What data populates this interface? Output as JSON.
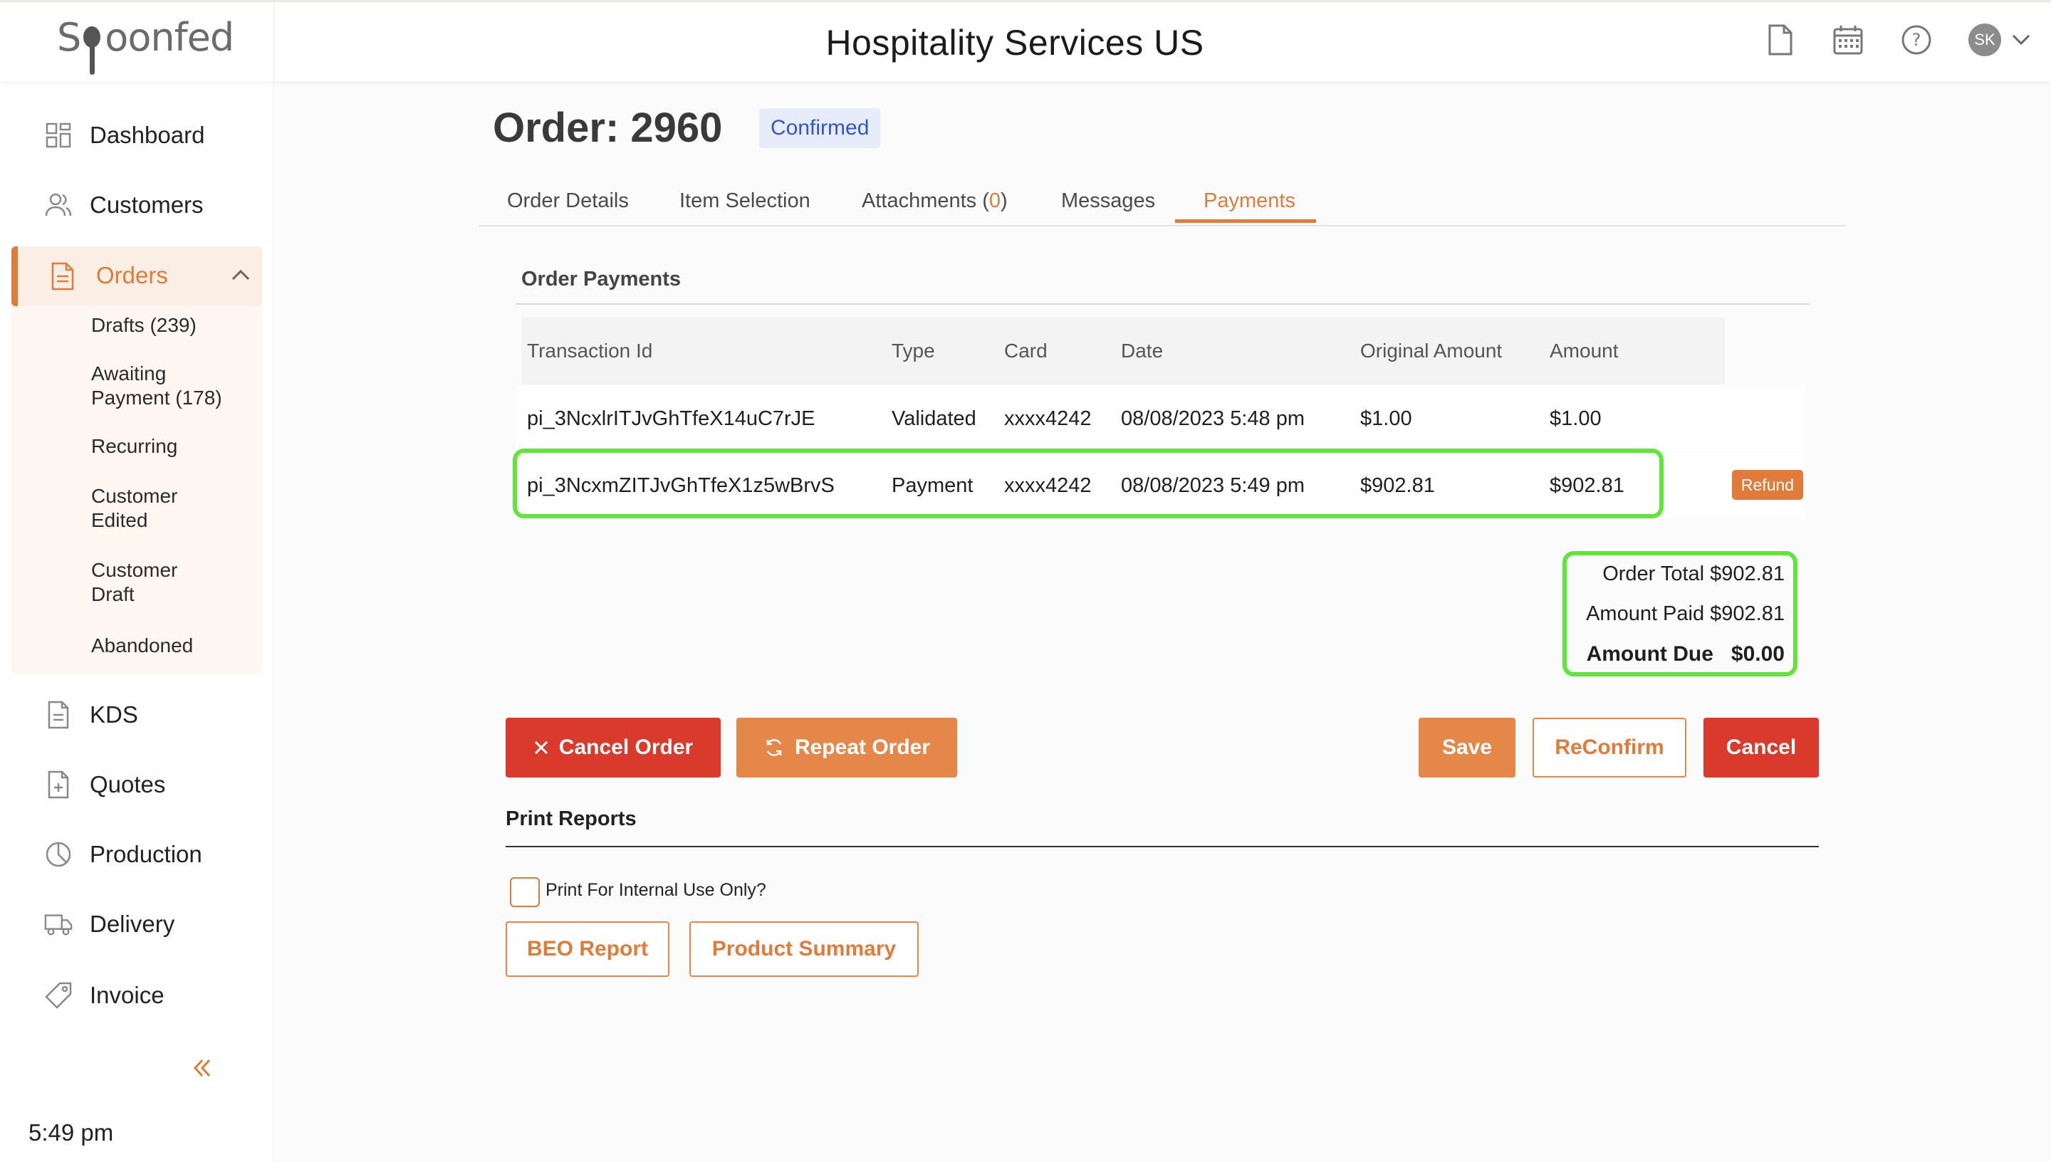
{
  "app": {
    "logo_text": "Spoonfed",
    "title": "Hospitality Services US",
    "user_initials": "SK"
  },
  "sidebar": {
    "items": [
      {
        "label": "Dashboard",
        "icon": "grid-icon"
      },
      {
        "label": "Customers",
        "icon": "users-icon"
      },
      {
        "label": "Orders",
        "icon": "document-icon"
      },
      {
        "label": "KDS",
        "icon": "document-icon"
      },
      {
        "label": "Quotes",
        "icon": "document-plus-icon"
      },
      {
        "label": "Production",
        "icon": "pie-icon"
      },
      {
        "label": "Delivery",
        "icon": "truck-icon"
      },
      {
        "label": "Invoice",
        "icon": "tag-icon"
      }
    ],
    "order_subitems": [
      "Drafts (239)",
      "Awaiting Payment (178)",
      "Recurring",
      "Customer Edited",
      "Customer Draft",
      "Abandoned"
    ],
    "time": "5:49 pm"
  },
  "order": {
    "title": "Order: 2960",
    "status": "Confirmed"
  },
  "tabs": [
    {
      "label": "Order Details"
    },
    {
      "label": "Item Selection"
    },
    {
      "label": "Attachments (",
      "count": "0",
      "suffix": ")"
    },
    {
      "label": "Messages"
    },
    {
      "label": "Payments"
    }
  ],
  "payments": {
    "section_title": "Order Payments",
    "columns": [
      "Transaction Id",
      "Type",
      "Card",
      "Date",
      "Original Amount",
      "Amount"
    ],
    "rows": [
      {
        "transaction_id": "pi_3NcxlrITJvGhTfeX14uC7rJE",
        "type": "Validated",
        "card": "xxxx4242",
        "date": "08/08/2023 5:48 pm",
        "original_amount": "$1.00",
        "amount": "$1.00"
      },
      {
        "transaction_id": "pi_3NcxmZITJvGhTfeX1z5wBrvS",
        "type": "Payment",
        "card": "xxxx4242",
        "date": "08/08/2023 5:49 pm",
        "original_amount": "$902.81",
        "amount": "$902.81",
        "action": "Refund"
      }
    ],
    "totals": {
      "order_total": "Order Total $902.81",
      "amount_paid": "Amount Paid $902.81",
      "amount_due_label": "Amount Due",
      "amount_due_value": "$0.00"
    }
  },
  "actions": {
    "cancel_order": "Cancel Order",
    "repeat_order": "Repeat Order",
    "save": "Save",
    "reconfirm": "ReConfirm",
    "cancel": "Cancel"
  },
  "print_reports": {
    "title": "Print Reports",
    "internal_checkbox": "Print For Internal Use Only?",
    "beo_report": "BEO Report",
    "product_summary": "Product Summary"
  },
  "colors": {
    "accent": "#e07b39",
    "danger": "#d93a2b",
    "highlight": "#62e53b",
    "badge_bg": "#e6ecfa",
    "badge_text": "#3256c8"
  }
}
